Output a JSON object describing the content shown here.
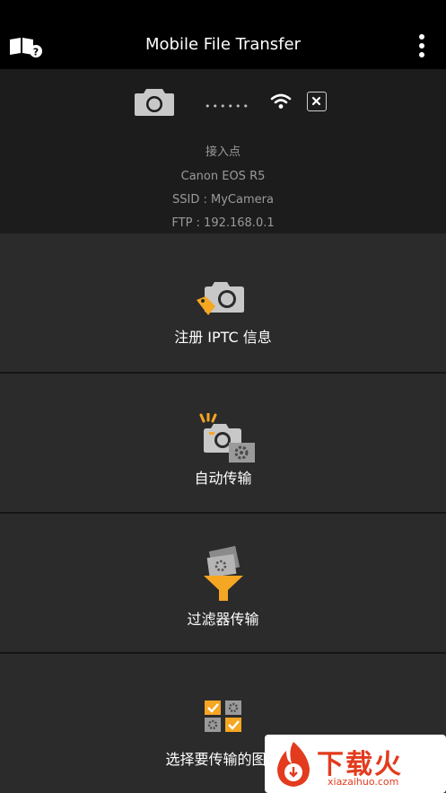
{
  "header": {
    "title": "Mobile File Transfer",
    "help_icon": "book-question-icon",
    "menu_icon": "more-vertical-icon"
  },
  "connection": {
    "dots": "••••••",
    "access_point_label": "接入点",
    "camera_model": "Canon EOS R5",
    "ssid": "SSID : MyCamera",
    "ftp": "FTP : 192.168.0.1"
  },
  "menu": {
    "items": [
      {
        "label": "注册 IPTC 信息",
        "icon": "camera-tag-icon"
      },
      {
        "label": "自动传输",
        "icon": "camera-auto-gear-icon"
      },
      {
        "label": "过滤器传输",
        "icon": "filter-funnel-icon"
      },
      {
        "label": "选择要传输的图像",
        "icon": "select-images-icon"
      }
    ]
  },
  "watermark": {
    "text": "下载火",
    "url": "xiazaihuo.com"
  },
  "colors": {
    "accent": "#f5a623",
    "header_bg": "#000000",
    "status_bg": "#1c1c1c",
    "item_bg": "#2b2b2b"
  }
}
